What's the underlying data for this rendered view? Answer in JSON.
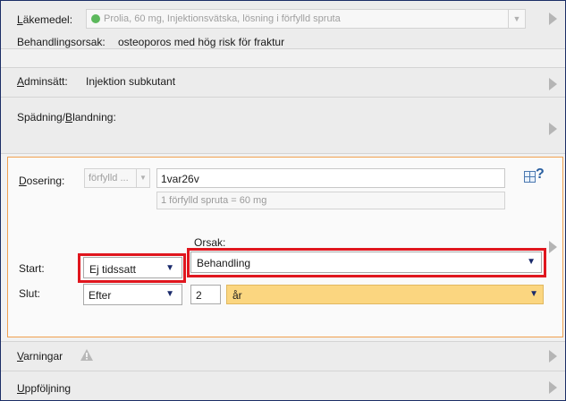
{
  "lakemedel": {
    "label_prefix": "",
    "label_underline": "L",
    "label_rest": "äkemedel:",
    "value": "Prolia, 60 mg, Injektionsvätska, lösning i förfylld spruta"
  },
  "behandlingsorsak": {
    "label": "Behandlingsorsak:",
    "value": "osteoporos med hög risk för fraktur"
  },
  "adminsatt": {
    "label_underline": "A",
    "label_rest": "dminsätt:",
    "value": "Injektion subkutant"
  },
  "spadning": {
    "label_a": "Spädning/",
    "label_underline": "B",
    "label_rest": "landning:"
  },
  "dosering": {
    "label_underline": "D",
    "label_rest": "osering:",
    "form_select": "förfylld ...",
    "dose_value": "1var26v",
    "dose_info": "1 förfylld spruta = 60 mg",
    "help": "?"
  },
  "orsak": {
    "label": "Orsak:",
    "value": "Behandling"
  },
  "start": {
    "label": "Start:",
    "value": "Ej tidssatt"
  },
  "slut": {
    "label": "Slut:",
    "mode": "Efter",
    "amount": "2",
    "unit": "år"
  },
  "varningar": {
    "label_underline": "V",
    "label_rest": "arningar"
  },
  "uppfoljning": {
    "label_underline": "U",
    "label_rest": "ppföljning"
  },
  "colors": {
    "highlight_red": "#e0161e",
    "orange_border": "#f0a050",
    "yellow_field": "#fbd680",
    "green_dot": "#5cb85c",
    "dark_blue_arrow": "#1a2a6b"
  }
}
